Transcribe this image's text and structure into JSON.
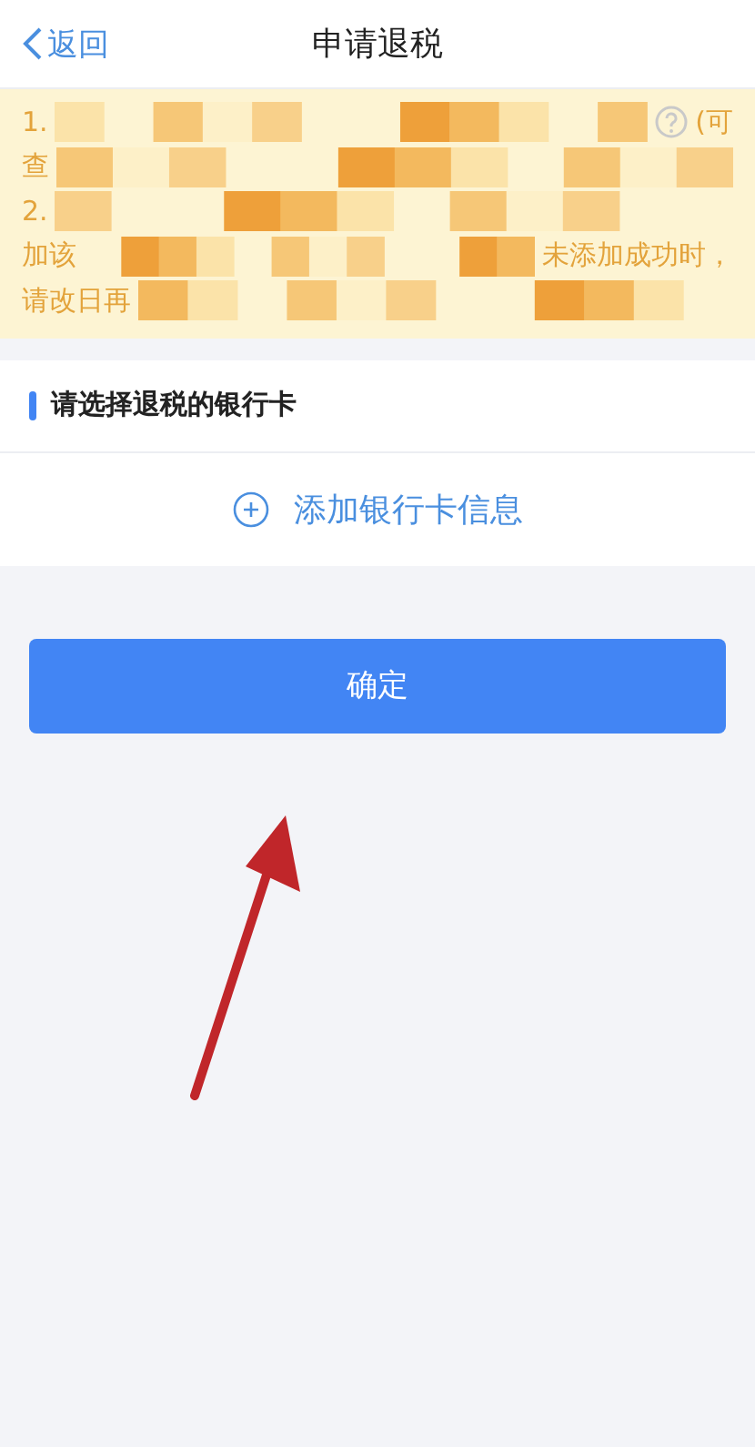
{
  "nav": {
    "back": "返回",
    "title": "申请退税"
  },
  "notice": {
    "lines": [
      {
        "kind": "help",
        "start": "1.",
        "end": "(可"
      },
      {
        "kind": "plain",
        "start": "查"
      },
      {
        "kind": "plain",
        "start": "2."
      },
      {
        "kind": "plain",
        "start": "加该",
        "end": "未添加成功时，"
      },
      {
        "kind": "plain",
        "start": "请改日再"
      }
    ]
  },
  "section": {
    "title": "请选择退税的银行卡"
  },
  "add_card": {
    "label": "添加银行卡信息"
  },
  "confirm": {
    "label": "确定"
  }
}
